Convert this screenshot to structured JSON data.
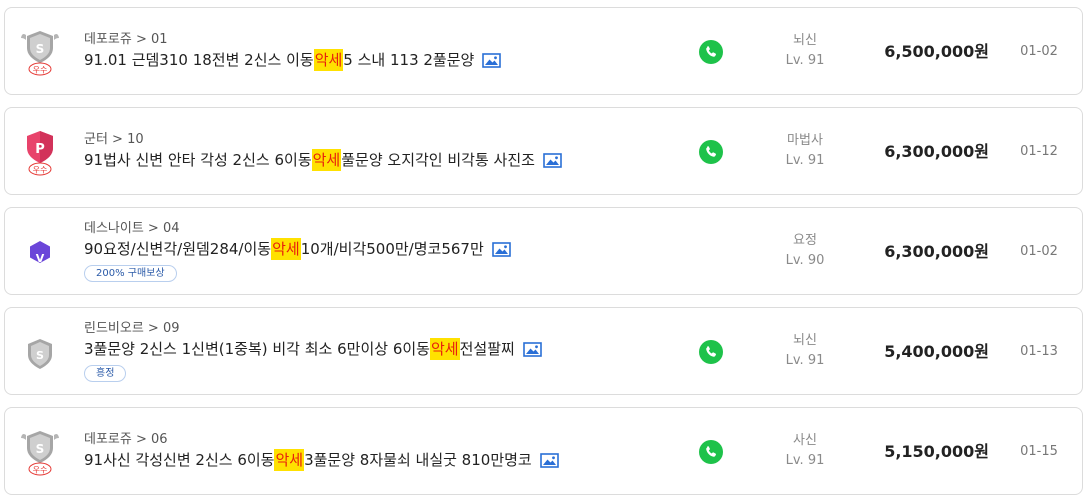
{
  "listings": [
    {
      "badge": "shield-silver-excellent",
      "badge_text": "우수",
      "server": "데포로쥬 > 01",
      "title_pre": "91.01 근뎀310 18전변 2신스 이동",
      "title_hl": "악세",
      "title_post": "5 스내 113 2풀문양",
      "class": "뇌신",
      "level": "Lv. 91",
      "price": "6,500,000원",
      "date": "01-02"
    },
    {
      "badge": "shield-pink-p-excellent",
      "badge_text": "우수",
      "server": "군터 > 10",
      "title_pre": "91법사 신변 안타 각성 2신스 6이동",
      "title_hl": "악세",
      "title_post": " 풀문양 오지각인 비각통 사진조",
      "class": "마법사",
      "level": "Lv. 91",
      "price": "6,300,000원",
      "date": "01-12"
    },
    {
      "badge": "hexagon-purple-v",
      "server": "데스나이트 > 04",
      "title_pre": "90요정/신변각/원뎀284/이동",
      "title_hl": "악세",
      "title_post": "10개/비각500만/명코567만",
      "tag": "200% 구매보상",
      "class": "요정",
      "level": "Lv. 90",
      "price": "6,300,000원",
      "date": "01-02"
    },
    {
      "badge": "shield-silver",
      "server": "린드비오르 > 09",
      "title_pre": "3풀문양 2신스 1신변(1중복) 비각 최소 6만이상 6이동",
      "title_hl": "악세",
      "title_post": " 전설팔찌",
      "tag": "흥정",
      "class": "뇌신",
      "level": "Lv. 91",
      "price": "5,400,000원",
      "date": "01-13"
    },
    {
      "badge": "shield-silver-excellent",
      "badge_text": "우수",
      "server": "데포로쥬 > 06",
      "title_pre": "91사신 각성신변 2신스 6이동",
      "title_hl": "악세",
      "title_post": " 3풀문양 8자물쇠 내실굿 810만명코",
      "class": "사신",
      "level": "Lv. 91",
      "price": "5,150,000원",
      "date": "01-15"
    }
  ],
  "colors": {
    "highlight_bg": "#ffe100",
    "highlight_text": "#e8200c",
    "phone_green": "#1ec24a",
    "tag_border": "#b9cfee",
    "tag_text": "#2a5aa8",
    "badge_purple": "#6b46d9",
    "badge_pink": "#e8436b",
    "badge_silver": "#9e9e9e"
  }
}
